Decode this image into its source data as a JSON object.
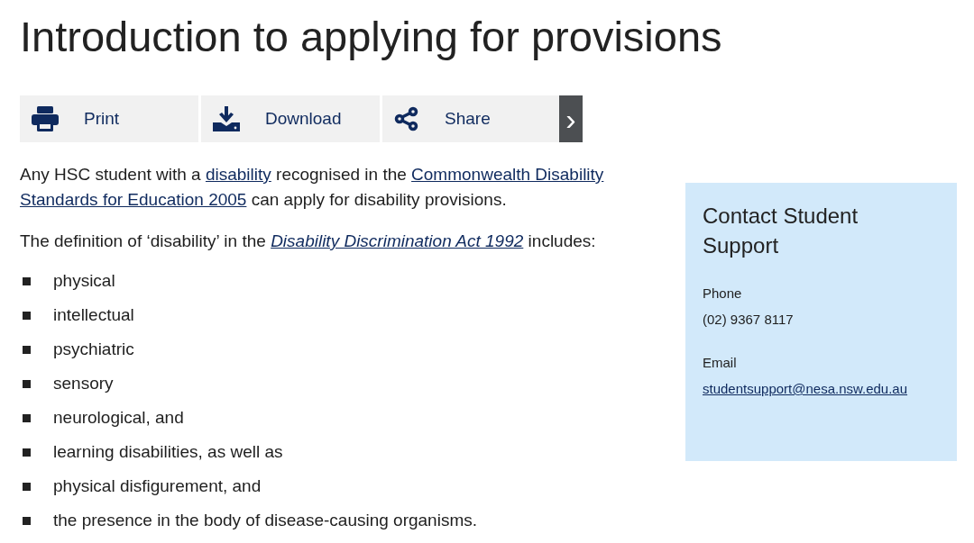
{
  "title": "Introduction to applying for provisions",
  "toolbar": [
    {
      "label": "Print",
      "kind": "print"
    },
    {
      "label": "Download",
      "kind": "download"
    },
    {
      "label": "Share",
      "kind": "share"
    }
  ],
  "toolbar_next": "›",
  "paragraphs": [
    [
      {
        "text": "Any HSC student with a "
      },
      {
        "text": "disability",
        "kind": "link"
      },
      {
        "text": " recognised in the "
      },
      {
        "text": "Commonwealth Disability ",
        "kind": "link"
      },
      {
        "text": "Standards for Education 2005",
        "kind": "link"
      },
      {
        "text": " can apply for disability provisions."
      }
    ],
    [
      {
        "text": "The definition of ‘disability’ in the "
      },
      {
        "text": "Disability Discrimination Act 1992",
        "kind": "italic_link"
      },
      {
        "text": " includes:"
      }
    ]
  ],
  "list": [
    "physical",
    "intellectual",
    "psychiatric",
    "sensory",
    "neurological, and",
    "learning disabilities, as well as",
    "physical disfigurement, and",
    "the presence in the body of disease-causing organisms."
  ],
  "contact": {
    "title": "Contact Student Support",
    "fields": [
      {
        "label": "Phone",
        "value": "(02) 9367 8117",
        "kind": "text"
      },
      {
        "label": "Email",
        "value": "studentsupport@nesa.nsw.edu.au",
        "kind": "link"
      }
    ]
  }
}
